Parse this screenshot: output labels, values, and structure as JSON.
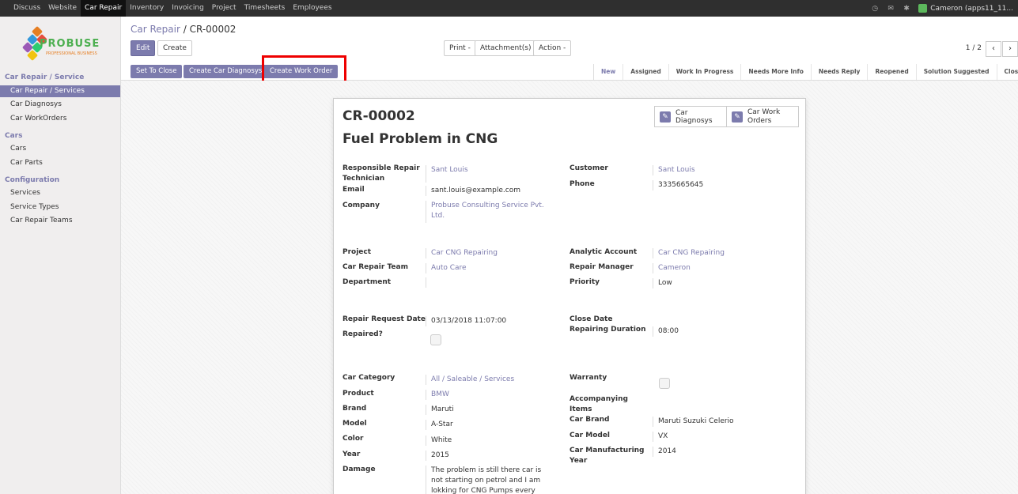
{
  "topbar": {
    "menu": [
      "Discuss",
      "Website",
      "Car Repair",
      "Inventory",
      "Invoicing",
      "Project",
      "Timesheets",
      "Employees"
    ],
    "active": "Car Repair",
    "user": "Cameron (apps11_11..."
  },
  "logo": {
    "brand": "PROBUSE",
    "tagline": "PROFESSIONAL BUSINESS"
  },
  "sidebar": {
    "sections": [
      {
        "title": "Car Repair / Service",
        "items": [
          "Car Repair / Services",
          "Car Diagnosys",
          "Car WorkOrders"
        ]
      },
      {
        "title": "Cars",
        "items": [
          "Cars",
          "Car Parts"
        ]
      },
      {
        "title": "Configuration",
        "items": [
          "Services",
          "Service Types",
          "Car Repair Teams"
        ]
      }
    ],
    "active_item": "Car Repair / Services"
  },
  "breadcrumb": {
    "parent": "Car Repair",
    "separator": "/",
    "current": "CR-00002"
  },
  "toolbar": {
    "edit": "Edit",
    "create": "Create",
    "print": "Print -",
    "attachments": "Attachment(s) -",
    "action": "Action -",
    "pager": "1 / 2",
    "prev": "‹",
    "next": "›"
  },
  "header_buttons": [
    "Set To Close",
    "Create Car Diagnosys",
    "Create Work Order"
  ],
  "stages": [
    "New",
    "Assigned",
    "Work In Progress",
    "Needs More Info",
    "Needs Reply",
    "Reopened",
    "Solution Suggested",
    "Closed"
  ],
  "current_stage": "New",
  "record": {
    "reference": "CR-00002",
    "name": "Fuel Problem in CNG",
    "smart_buttons": {
      "diagnosys": "Car Diagnosys",
      "work_orders_l1": "Car Work",
      "work_orders_l2": "Orders"
    },
    "left1": [
      {
        "label": "Responsible Repair Technician",
        "value": "Sant Louis",
        "link": true
      },
      {
        "label": "Email",
        "value": "sant.louis@example.com",
        "link": false
      },
      {
        "label": "Company",
        "value": "Probuse Consulting Service Pvt. Ltd.",
        "link": true
      }
    ],
    "right1": [
      {
        "label": "Customer",
        "value": "Sant Louis",
        "link": true
      },
      {
        "label": "Phone",
        "value": "3335665645",
        "link": false
      }
    ],
    "left2": [
      {
        "label": "Project",
        "value": "Car CNG Repairing",
        "link": true
      },
      {
        "label": "Car Repair Team",
        "value": "Auto Care",
        "link": true
      },
      {
        "label": "Department",
        "value": "",
        "link": false
      }
    ],
    "right2": [
      {
        "label": "Analytic Account",
        "value": "Car CNG Repairing",
        "link": true
      },
      {
        "label": "Repair Manager",
        "value": "Cameron",
        "link": true
      },
      {
        "label": "Priority",
        "value": "Low",
        "link": false
      }
    ],
    "left3": [
      {
        "label": "Repair Request Date",
        "value": "03/13/2018 11:07:00"
      },
      {
        "label": "Repaired?",
        "value": ""
      }
    ],
    "right3": [
      {
        "label": "Close Date",
        "value": ""
      },
      {
        "label": "Repairing Duration",
        "value": "08:00"
      }
    ],
    "left4": [
      {
        "label": "Car Category",
        "value": "All / Saleable / Services",
        "link": true
      },
      {
        "label": "Product",
        "value": "BMW",
        "link": true
      },
      {
        "label": "Brand",
        "value": "Maruti",
        "link": false
      },
      {
        "label": "Model",
        "value": "A-Star",
        "link": false
      },
      {
        "label": "Color",
        "value": "White",
        "link": false
      },
      {
        "label": "Year",
        "value": "2015",
        "link": false
      },
      {
        "label": "Damage",
        "value": "The problem is still there car is not starting on petrol and I am lokking for CNG Pumps every now and",
        "link": false
      }
    ],
    "right4": [
      {
        "label": "Warranty",
        "value": ""
      },
      {
        "label": "Accompanying Items",
        "value": ""
      },
      {
        "label": "Car Brand",
        "value": "Maruti Suzuki Celerio"
      },
      {
        "label": "Car Model",
        "value": "VX"
      },
      {
        "label": "Car Manufacturing Year",
        "value": "2014"
      }
    ]
  }
}
